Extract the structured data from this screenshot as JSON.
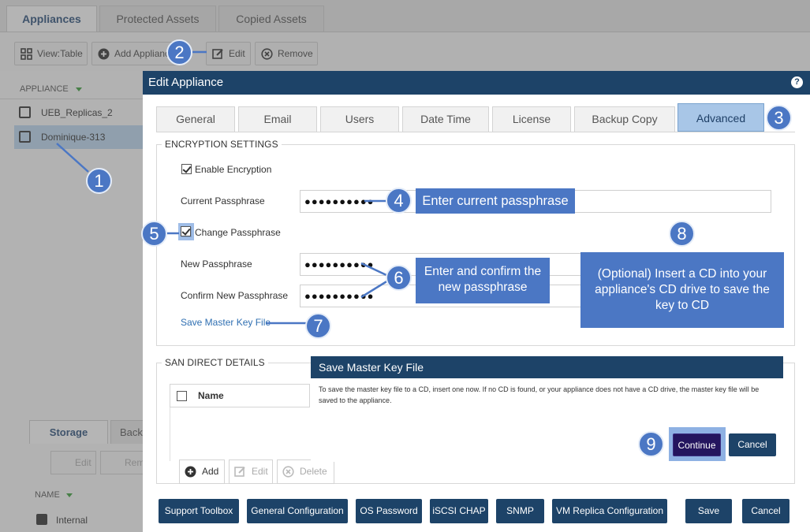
{
  "app_tabs": [
    "Appliances",
    "Protected Assets",
    "Copied Assets"
  ],
  "toolbar": {
    "view": "View:Table",
    "add": "Add Appliance",
    "edit": "Edit",
    "remove": "Remove"
  },
  "appliance_list": {
    "header": "APPLIANCE",
    "items": [
      "UEB_Replicas_2",
      "Dominique-313"
    ]
  },
  "lower_panel": {
    "tabs": [
      "Storage",
      "Back"
    ],
    "edit": "Edit",
    "remove": "Rem",
    "name_header": "NAME",
    "row": "Internal"
  },
  "dialog": {
    "title": "Edit Appliance",
    "help": "?",
    "tabs": [
      "General",
      "Email",
      "Users",
      "Date Time",
      "License",
      "Backup Copy",
      "Advanced"
    ],
    "encryption": {
      "legend": "ENCRYPTION SETTINGS",
      "enable": "Enable Encryption",
      "current_label": "Current Passphrase",
      "current_value": "●●●●●●●●●●",
      "change": "Change Passphrase",
      "new_label": "New Passphrase",
      "new_value": "●●●●●●●●●●",
      "confirm_label": "Confirm New Passphrase",
      "confirm_value": "●●●●●●●●●●",
      "save_key_link": "Save Master Key File"
    },
    "san": {
      "legend": "SAN DIRECT DETAILS",
      "name_header": "Name",
      "add": "Add",
      "edit": "Edit",
      "delete": "Delete"
    },
    "bottom_buttons": [
      "Support Toolbox",
      "General Configuration",
      "OS Password",
      "iSCSI CHAP",
      "SNMP",
      "VM Replica Configuration"
    ],
    "save": "Save",
    "cancel": "Cancel"
  },
  "popup": {
    "title": "Save Master Key File",
    "message": "To save the master key file to a CD, insert one now. If no CD is found, or your appliance does not have a CD drive, the master key file will be saved to the appliance.",
    "continue": "Continue",
    "cancel": "Cancel"
  },
  "annotations": {
    "numbers": [
      "1",
      "2",
      "3",
      "4",
      "5",
      "6",
      "7",
      "8",
      "9"
    ],
    "callout_current": "Enter current passphrase",
    "callout_new": "Enter and confirm the new passphrase",
    "callout_cd": "(Optional) Insert a CD into your appliance's CD drive to save the key to CD"
  },
  "colors": {
    "title_bar": "#1d4368",
    "annotation": "#4b77c4",
    "active_tab": "#a8c6e7",
    "link": "#2f6fb2"
  }
}
